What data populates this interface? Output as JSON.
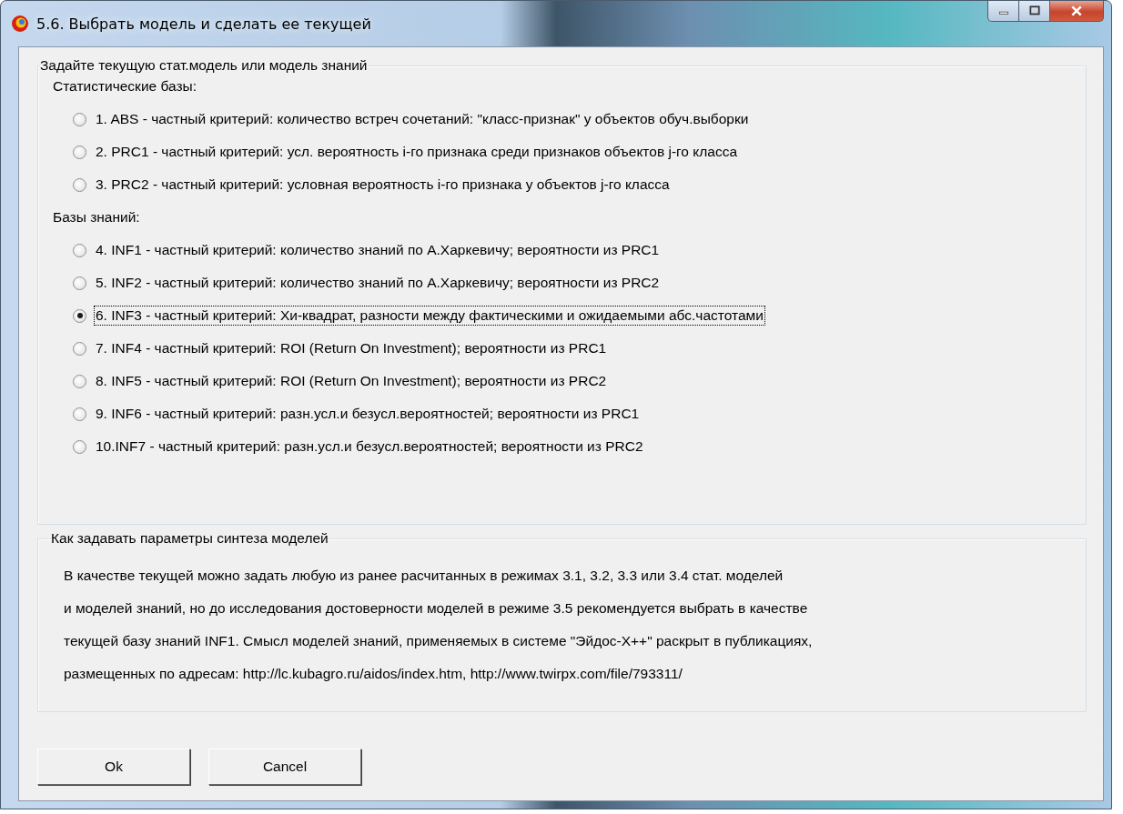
{
  "window": {
    "title": "5.6. Выбрать модель и сделать ее текущей"
  },
  "model_group": {
    "title": "Задайте текущую стат.модель или модель знаний",
    "sections": [
      {
        "heading": "Статистические базы:",
        "options": [
          {
            "label": "1. ABS  - частный критерий: количество встреч сочетаний: \"класс-признак\" у объектов обуч.выборки",
            "selected": false,
            "focused": false
          },
          {
            "label": "2. PRC1 - частный критерий: усл. вероятность i-го признака среди признаков объектов j-го класса",
            "selected": false,
            "focused": false
          },
          {
            "label": "3. PRC2 - частный критерий: условная вероятность i-го признака у объектов j-го класса",
            "selected": false,
            "focused": false
          }
        ]
      },
      {
        "heading": "Базы знаний:",
        "options": [
          {
            "label": "4. INF1 - частный критерий: количество знаний по А.Харкевичу; вероятности из PRC1",
            "selected": false,
            "focused": false
          },
          {
            "label": "5. INF2 - частный критерий: количество знаний по А.Харкевичу; вероятности из PRC2",
            "selected": false,
            "focused": false
          },
          {
            "label": "6. INF3 - частный критерий: Хи-квадрат, разности между фактическими и ожидаемыми абс.частотами",
            "selected": true,
            "focused": true
          },
          {
            "label": "7. INF4 - частный критерий: ROI (Return On Investment); вероятности из PRC1",
            "selected": false,
            "focused": false
          },
          {
            "label": "8. INF5 - частный критерий: ROI (Return On Investment); вероятности из PRC2",
            "selected": false,
            "focused": false
          },
          {
            "label": "9. INF6 - частный критерий: разн.усл.и безусл.вероятностей; вероятности из PRC1",
            "selected": false,
            "focused": false
          },
          {
            "label": "10.INF7 - частный критерий: разн.усл.и безусл.вероятностей; вероятности из PRC2",
            "selected": false,
            "focused": false
          }
        ]
      }
    ]
  },
  "help_group": {
    "title": "Как задавать параметры синтеза моделей",
    "lines": [
      "В качестве текущей можно задать любую из ранее расчитанных в режимах 3.1, 3.2, 3.3 или 3.4 стат. моделей",
      "и моделей знаний, но до исследования достоверности моделей в режиме 3.5 рекомендуется выбрать в качестве",
      "текущей базу знаний INF1. Смысл моделей знаний, применяемых в системе \"Эйдос-Х++\" раскрыт в публикациях,",
      "размещенных по адресам: http://lc.kubagro.ru/aidos/index.htm, http://www.twirpx.com/file/793311/"
    ]
  },
  "buttons": [
    {
      "label": "Ok"
    },
    {
      "label": "Cancel"
    }
  ]
}
